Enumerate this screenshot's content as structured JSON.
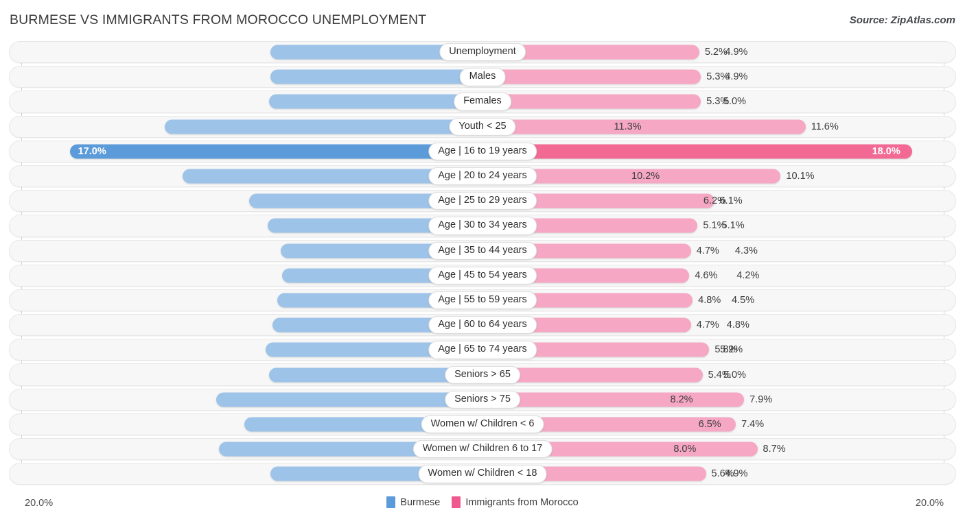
{
  "header": {
    "title": "BURMESE VS IMMIGRANTS FROM MOROCCO UNEMPLOYMENT",
    "source": "Source: ZipAtlas.com"
  },
  "axis": {
    "left_label": "20.0%",
    "right_label": "20.0%",
    "max": 20.0
  },
  "legend": {
    "items": [
      {
        "label": "Burmese",
        "color": "#5b9bd9"
      },
      {
        "label": "Immigrants from Morocco",
        "color": "#f0598f"
      }
    ]
  },
  "colors": {
    "left_bar": "#9dc3e8",
    "right_bar": "#f5a7c3",
    "left_bar_highlight": "#5b9bd9",
    "right_bar_highlight": "#f26a94",
    "track": "#f7f7f7",
    "gridline": "#d3d3d3"
  },
  "chart_data": {
    "type": "bar",
    "title": "BURMESE VS IMMIGRANTS FROM MOROCCO UNEMPLOYMENT",
    "subtitle": "",
    "xlabel": "",
    "ylabel": "",
    "orientation": "horizontal-diverging",
    "xlim": [
      0,
      20.0
    ],
    "grid": false,
    "legend_position": "bottom-center",
    "categories": [
      "Unemployment",
      "Males",
      "Females",
      "Youth < 25",
      "Age | 16 to 19 years",
      "Age | 20 to 24 years",
      "Age | 25 to 29 years",
      "Age | 30 to 34 years",
      "Age | 35 to 44 years",
      "Age | 45 to 54 years",
      "Age | 55 to 59 years",
      "Age | 60 to 64 years",
      "Age | 65 to 74 years",
      "Seniors > 65",
      "Seniors > 75",
      "Women w/ Children < 6",
      "Women w/ Children 6 to 17",
      "Women w/ Children < 18"
    ],
    "series": [
      {
        "name": "Burmese",
        "color": "#5b9bd9",
        "values": [
          4.9,
          4.9,
          5.0,
          11.3,
          17.0,
          10.2,
          6.2,
          5.1,
          4.3,
          4.2,
          4.5,
          4.8,
          5.2,
          5.0,
          8.2,
          6.5,
          8.0,
          4.9
        ]
      },
      {
        "name": "Immigrants from Morocco",
        "color": "#f0598f",
        "values": [
          5.2,
          5.3,
          5.3,
          11.6,
          18.0,
          10.1,
          6.1,
          5.1,
          4.7,
          4.6,
          4.8,
          4.7,
          5.8,
          5.4,
          7.9,
          7.4,
          8.7,
          5.6
        ]
      }
    ]
  },
  "rows": [
    {
      "label": "Unemployment",
      "left": "4.9%",
      "right": "5.2%",
      "lv": 4.9,
      "rv": 5.2,
      "highlight": false
    },
    {
      "label": "Males",
      "left": "4.9%",
      "right": "5.3%",
      "lv": 4.9,
      "rv": 5.3,
      "highlight": false
    },
    {
      "label": "Females",
      "left": "5.0%",
      "right": "5.3%",
      "lv": 5.0,
      "rv": 5.3,
      "highlight": false
    },
    {
      "label": "Youth < 25",
      "left": "11.3%",
      "right": "11.6%",
      "lv": 11.3,
      "rv": 11.6,
      "highlight": false
    },
    {
      "label": "Age | 16 to 19 years",
      "left": "17.0%",
      "right": "18.0%",
      "lv": 17.0,
      "rv": 18.0,
      "highlight": true
    },
    {
      "label": "Age | 20 to 24 years",
      "left": "10.2%",
      "right": "10.1%",
      "lv": 10.2,
      "rv": 10.1,
      "highlight": false
    },
    {
      "label": "Age | 25 to 29 years",
      "left": "6.2%",
      "right": "6.1%",
      "lv": 6.2,
      "rv": 6.1,
      "highlight": false
    },
    {
      "label": "Age | 30 to 34 years",
      "left": "5.1%",
      "right": "5.1%",
      "lv": 5.1,
      "rv": 5.1,
      "highlight": false
    },
    {
      "label": "Age | 35 to 44 years",
      "left": "4.3%",
      "right": "4.7%",
      "lv": 4.3,
      "rv": 4.7,
      "highlight": false
    },
    {
      "label": "Age | 45 to 54 years",
      "left": "4.2%",
      "right": "4.6%",
      "lv": 4.2,
      "rv": 4.6,
      "highlight": false
    },
    {
      "label": "Age | 55 to 59 years",
      "left": "4.5%",
      "right": "4.8%",
      "lv": 4.5,
      "rv": 4.8,
      "highlight": false
    },
    {
      "label": "Age | 60 to 64 years",
      "left": "4.8%",
      "right": "4.7%",
      "lv": 4.8,
      "rv": 4.7,
      "highlight": false
    },
    {
      "label": "Age | 65 to 74 years",
      "left": "5.2%",
      "right": "5.8%",
      "lv": 5.2,
      "rv": 5.8,
      "highlight": false
    },
    {
      "label": "Seniors > 65",
      "left": "5.0%",
      "right": "5.4%",
      "lv": 5.0,
      "rv": 5.4,
      "highlight": false
    },
    {
      "label": "Seniors > 75",
      "left": "8.2%",
      "right": "7.9%",
      "lv": 8.2,
      "rv": 7.9,
      "highlight": false
    },
    {
      "label": "Women w/ Children < 6",
      "left": "6.5%",
      "right": "7.4%",
      "lv": 6.5,
      "rv": 7.4,
      "highlight": false
    },
    {
      "label": "Women w/ Children 6 to 17",
      "left": "8.0%",
      "right": "8.7%",
      "lv": 8.0,
      "rv": 8.7,
      "highlight": false
    },
    {
      "label": "Women w/ Children < 18",
      "left": "4.9%",
      "right": "5.6%",
      "lv": 4.9,
      "rv": 5.6,
      "highlight": false
    }
  ]
}
